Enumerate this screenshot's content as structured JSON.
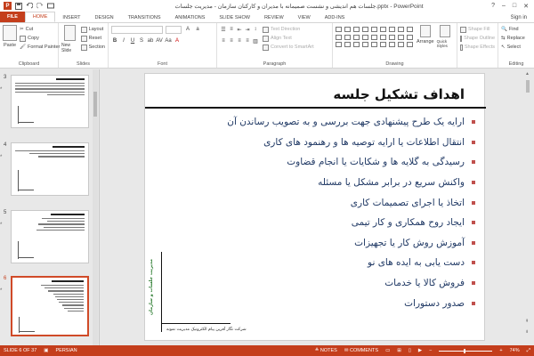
{
  "window": {
    "title": "جلسات هم اندیشی و نشست صمیمانه با مدیران و کارکنان سازمان - مدیریت جلسات.pptx - PowerPoint",
    "signin": "Sign in",
    "minimize": "–",
    "maximize": "□",
    "close": "✕"
  },
  "tabs": [
    "FILE",
    "HOME",
    "INSERT",
    "DESIGN",
    "TRANSITIONS",
    "ANIMATIONS",
    "SLIDE SHOW",
    "REVIEW",
    "VIEW",
    "ADD-INS"
  ],
  "ribbon": {
    "clipboard": {
      "paste": "Paste",
      "cut": "Cut",
      "copy": "Copy",
      "format_painter": "Format Painter",
      "label": "Clipboard"
    },
    "slides": {
      "new_slide": "New Slide",
      "layout": "Layout",
      "reset": "Reset",
      "section": "Section",
      "label": "Slides"
    },
    "font": {
      "label": "Font"
    },
    "paragraph": {
      "text_direction": "Text Direction",
      "align_text": "Align Text",
      "convert_smartart": "Convert to SmartArt",
      "label": "Paragraph"
    },
    "drawing": {
      "arrange": "Arrange",
      "quick_styles": "Quick Styles",
      "shape_fill": "Shape Fill",
      "shape_outline": "Shape Outline",
      "shape_effects": "Shape Effects",
      "label": "Drawing"
    },
    "editing": {
      "find": "Find",
      "replace": "Replace",
      "select": "Select",
      "label": "Editing"
    }
  },
  "thumbnails": [
    {
      "num": "3"
    },
    {
      "num": "4"
    },
    {
      "num": "5"
    },
    {
      "num": "6"
    }
  ],
  "slide": {
    "title": "اهداف تشکیل جلسه",
    "bullets": [
      "ارایه یک طرح پیشنهادی جهت بررسی و به تصویب رساندن آن",
      "انتقال اطلاعات یا ارایه توصیه ها و رهنمود های کاری",
      "رسیدگی به گلایه ها و شکایات یا انجام قضاوت",
      "واکنش سریع در برابر مشکل یا مسئله",
      "اتخاذ یا اجرای تصمیمات کاری",
      "ایجاد روح همکاری و کار تیمی",
      "آموزش روش کار یا تجهیزات",
      "دست یابی به ایده های نو",
      "فروش کالا یا خدمات",
      "صدور دستورات"
    ],
    "side_text": "مدیریت جلسات و سازمان",
    "company": "شرکت نگار آفرین پیام الکترونیک مدیریت نمونه"
  },
  "status": {
    "slide_info": "SLIDE 6 OF 37",
    "language": "PERSIAN",
    "notes": "NOTES",
    "comments": "COMMENTS",
    "zoom": "74%"
  },
  "colors": {
    "accent": "#c43e1c",
    "bullet_text": "#1f3864",
    "bullet_marker": "#c0504d"
  }
}
